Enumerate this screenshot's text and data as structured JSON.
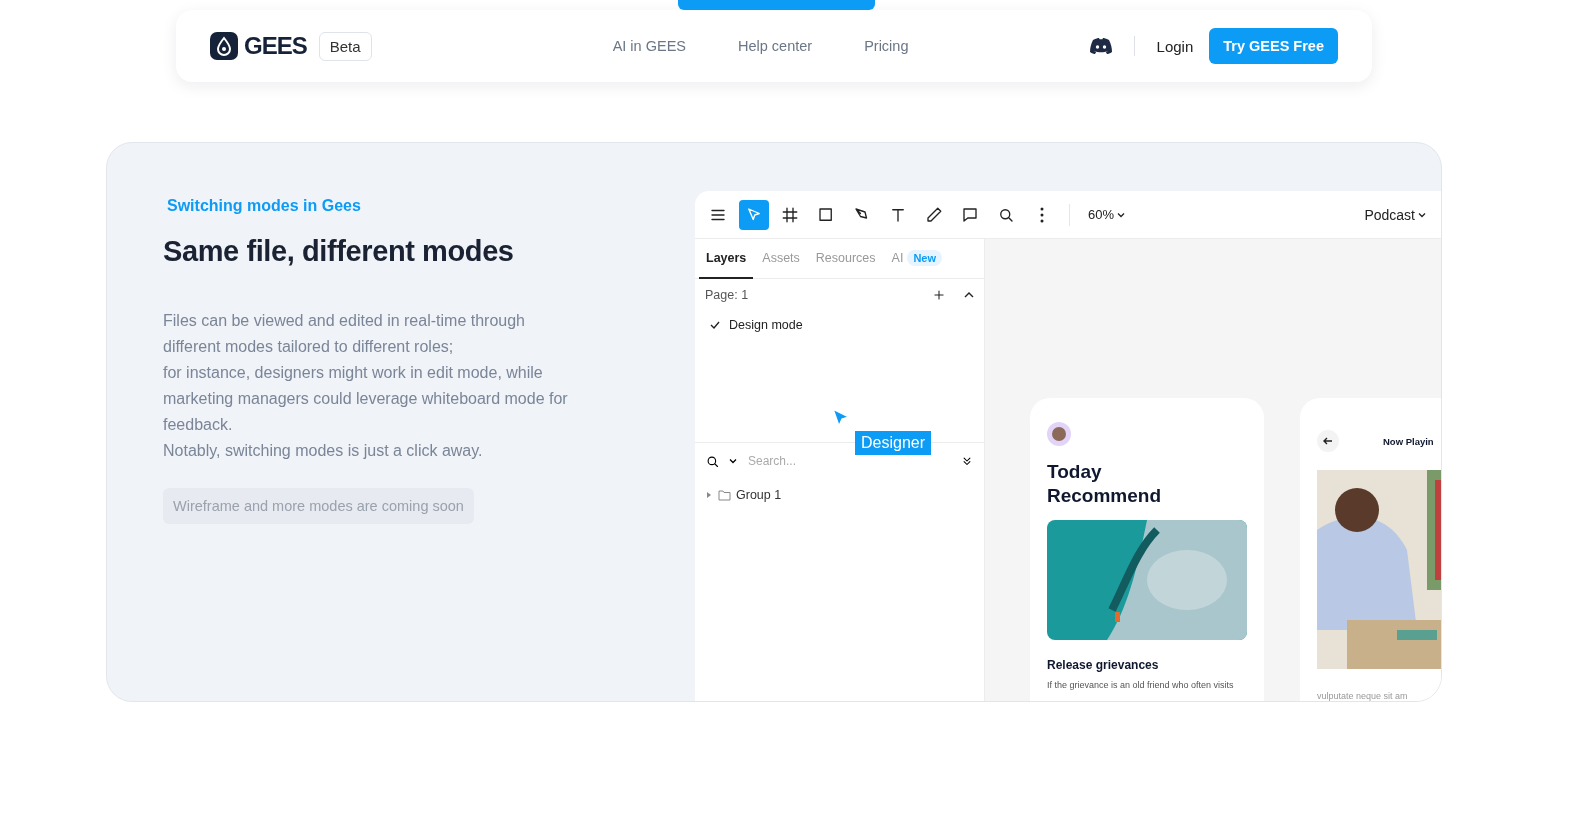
{
  "nav": {
    "brand": "GEES",
    "badge": "Beta",
    "links": [
      "AI in GEES",
      "Help center",
      "Pricing"
    ],
    "login": "Login",
    "cta": "Try GEES Free"
  },
  "feature": {
    "eyebrow": "Switching modes in Gees",
    "title": "Same file, different modes",
    "paragraphs": [
      "Files can be viewed and edited in real-time through different modes tailored to different roles;",
      "for instance, designers might work in edit mode, while marketing managers could leverage whiteboard mode for feedback.",
      "Notably, switching modes is just a click away."
    ],
    "note": "Wireframe and more modes are coming soon"
  },
  "editor": {
    "tools": [
      {
        "kind": "menu",
        "selected": false
      },
      {
        "kind": "select",
        "selected": true
      },
      {
        "kind": "frame",
        "selected": false
      },
      {
        "kind": "rect",
        "selected": false
      },
      {
        "kind": "pen",
        "selected": false
      },
      {
        "kind": "text",
        "selected": false
      },
      {
        "kind": "pencil",
        "selected": false
      },
      {
        "kind": "comment",
        "selected": false
      },
      {
        "kind": "search",
        "selected": false
      },
      {
        "kind": "more",
        "selected": false
      }
    ],
    "zoom": "60%",
    "file": "Podcast",
    "tabs": [
      {
        "label": "Layers",
        "selected": true
      },
      {
        "label": "Assets",
        "selected": false
      },
      {
        "label": "Resources",
        "selected": false
      },
      {
        "label": "AI",
        "selected": false,
        "badge": "New"
      }
    ],
    "page": "Page: 1",
    "modes": [
      {
        "label": "Design mode",
        "checked": true
      }
    ],
    "search": {
      "placeholder": "Search..."
    },
    "layers": [
      {
        "label": "Group 1",
        "expanded": false
      }
    ],
    "cursor": {
      "label": "Designer"
    },
    "cards": [
      {
        "kind": "recommend",
        "title": "Today Recommend",
        "heading": "Release grievances",
        "text": "If the grievance is an old friend who often visits"
      },
      {
        "kind": "player",
        "title": "Now Playin",
        "text": "vulputate neque sit am"
      }
    ]
  }
}
